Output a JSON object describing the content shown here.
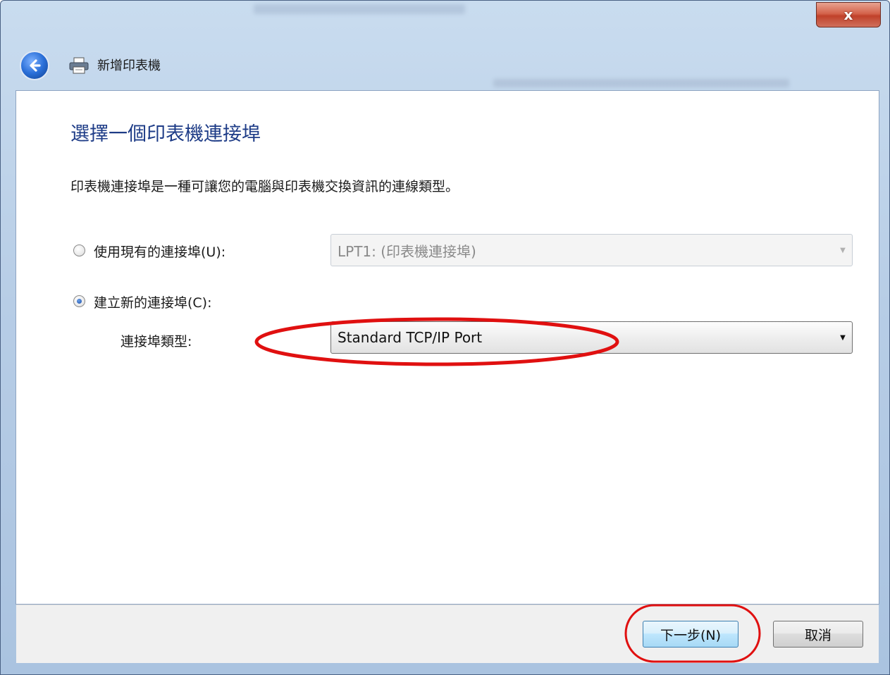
{
  "window": {
    "close_label": "x",
    "title": "新增印表機"
  },
  "page": {
    "heading": "選擇一個印表機連接埠",
    "description": "印表機連接埠是一種可讓您的電腦與印表機交換資訊的連線類型。"
  },
  "options": {
    "existing_port": {
      "label": "使用現有的連接埠(U):",
      "selected": false,
      "combo_value": "LPT1: (印表機連接埠)"
    },
    "new_port": {
      "label": "建立新的連接埠(C):",
      "selected": true,
      "type_label": "連接埠類型:",
      "combo_value": "Standard TCP/IP Port"
    }
  },
  "buttons": {
    "next": "下一步(N)",
    "cancel": "取消"
  },
  "colors": {
    "heading": "#1e3c87",
    "annotation": "#e01010"
  }
}
